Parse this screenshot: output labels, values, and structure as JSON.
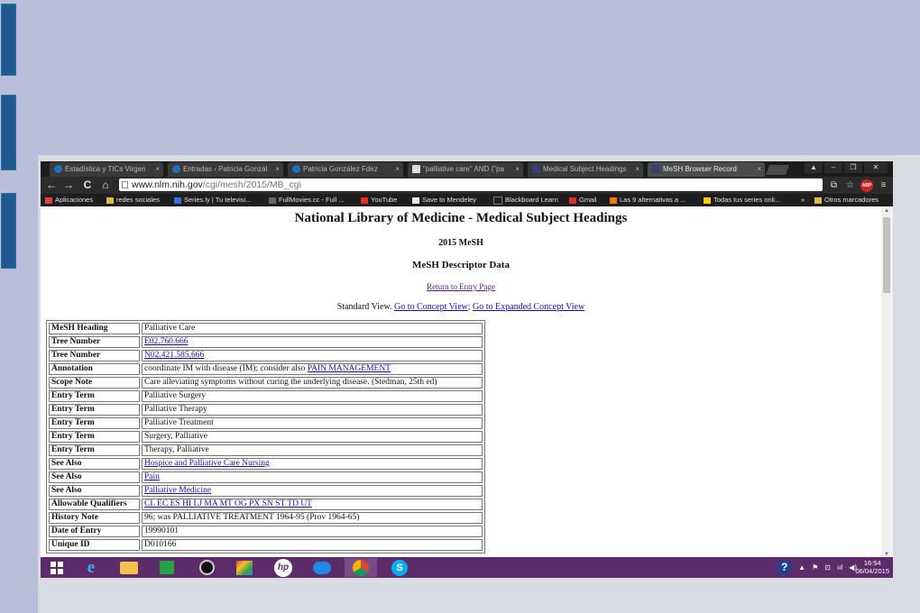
{
  "browser": {
    "tabs": [
      {
        "label": "Estadística y TICs Virgen",
        "close": "×"
      },
      {
        "label": "Entradas ‹ Patricia Gonzál",
        "close": "×"
      },
      {
        "label": "Patricia González Fdez",
        "close": "×"
      },
      {
        "label": "\"palliative care\" AND (\"pa",
        "close": "×"
      },
      {
        "label": "Medical Subject Headings",
        "close": "×"
      },
      {
        "label": "MeSH Browser Record",
        "close": "×"
      }
    ],
    "window_buttons": {
      "minimize": "–",
      "maximize": "❐",
      "close": "✕",
      "profile": "▲"
    },
    "nav": {
      "back": "←",
      "forward": "→",
      "reload": "C",
      "home": "⌂"
    },
    "url": {
      "host": "www.nlm.nih.gov",
      "path": "/cgi/mesh/2015/MB_cgi"
    },
    "abp_label": "ABP",
    "bookmarks": [
      {
        "label": "Aplicaciones",
        "color": "#e04040"
      },
      {
        "label": "redes sociales",
        "color": "#e6b84a"
      },
      {
        "label": "Series.ly | Tu televisi...",
        "color": "#3a6ee0"
      },
      {
        "label": "FullMovies.cc - Full ...",
        "color": "#666666"
      },
      {
        "label": "YouTube",
        "color": "#e52d27"
      },
      {
        "label": "Save to Mendeley",
        "color": "#e8e8e8"
      },
      {
        "label": "Blackboard Learn",
        "color": "#222222"
      },
      {
        "label": "Gmail",
        "color": "#d93025"
      },
      {
        "label": "Las 9 alternativas a ...",
        "color": "#f57c00"
      },
      {
        "label": "Todas tus series onli...",
        "color": "#ffcc00"
      },
      {
        "label": "»",
        "color": ""
      },
      {
        "label": "Otros marcadores",
        "color": "#e6b84a"
      }
    ]
  },
  "page": {
    "title": "National Library of Medicine - Medical Subject Headings",
    "year": "2015 MeSH",
    "subtitle": "MeSH Descriptor Data",
    "return_link": "Return to Entry Page",
    "views": {
      "standard": "Standard View.",
      "concept": "Go to Concept View",
      "sep": ";",
      "expanded": "Go to Expanded Concept View"
    },
    "rows": [
      {
        "label": "MeSH Heading",
        "value": "Palliative Care",
        "link": false
      },
      {
        "label": "Tree Number",
        "value": "E02.760.666",
        "link": true
      },
      {
        "label": "Tree Number",
        "value": "N02.421.585.666",
        "link": true
      },
      {
        "label": "Annotation",
        "value": "coordinate IM with disease (IM); consider also ",
        "link_text": "PAIN MANAGEMENT",
        "link": false
      },
      {
        "label": "Scope Note",
        "value": "Care alleviating symptoms without curing the underlying disease. (Stedman, 25th ed)",
        "link": false
      },
      {
        "label": "Entry Term",
        "value": "Palliative Surgery",
        "link": false
      },
      {
        "label": "Entry Term",
        "value": "Palliative Therapy",
        "link": false
      },
      {
        "label": "Entry Term",
        "value": "Palliative Treatment",
        "link": false
      },
      {
        "label": "Entry Term",
        "value": "Surgery, Palliative",
        "link": false
      },
      {
        "label": "Entry Term",
        "value": "Therapy, Palliative",
        "link": false
      },
      {
        "label": "See Also",
        "value": "Hospice and Palliative Care Nursing",
        "link": true
      },
      {
        "label": "See Also",
        "value": "Pain",
        "link": true
      },
      {
        "label": "See Also",
        "value": "Palliative Medicine",
        "link": true
      },
      {
        "label": "Allowable Qualifiers",
        "value": "CL EC ES HI LJ MA MT OG PX SN ST TD UT",
        "link": true
      },
      {
        "label": "History Note",
        "value": "96; was PALLIATIVE TREATMENT 1964-95 (Prov 1964-65)",
        "link": false
      },
      {
        "label": "Date of Entry",
        "value": "19990101",
        "link": false
      },
      {
        "label": "Unique ID",
        "value": "D010166",
        "link": false
      }
    ]
  },
  "taskbar": {
    "apps": [
      "windows-start",
      "internet-explorer",
      "file-explorer",
      "store",
      "media-player",
      "photos",
      "hp",
      "mail",
      "chrome",
      "skype"
    ],
    "tray_help": "?",
    "tray_icons": [
      "▲",
      "⚑",
      "⊡",
      "ııl",
      "◀)"
    ],
    "time": "16:54",
    "date": "06/04/2015"
  },
  "colors": {
    "slide_bg": "#b9bfd8",
    "side_bar": "#1e5a8f",
    "taskbar": "#5e2b6a",
    "link": "#1a0dab"
  }
}
